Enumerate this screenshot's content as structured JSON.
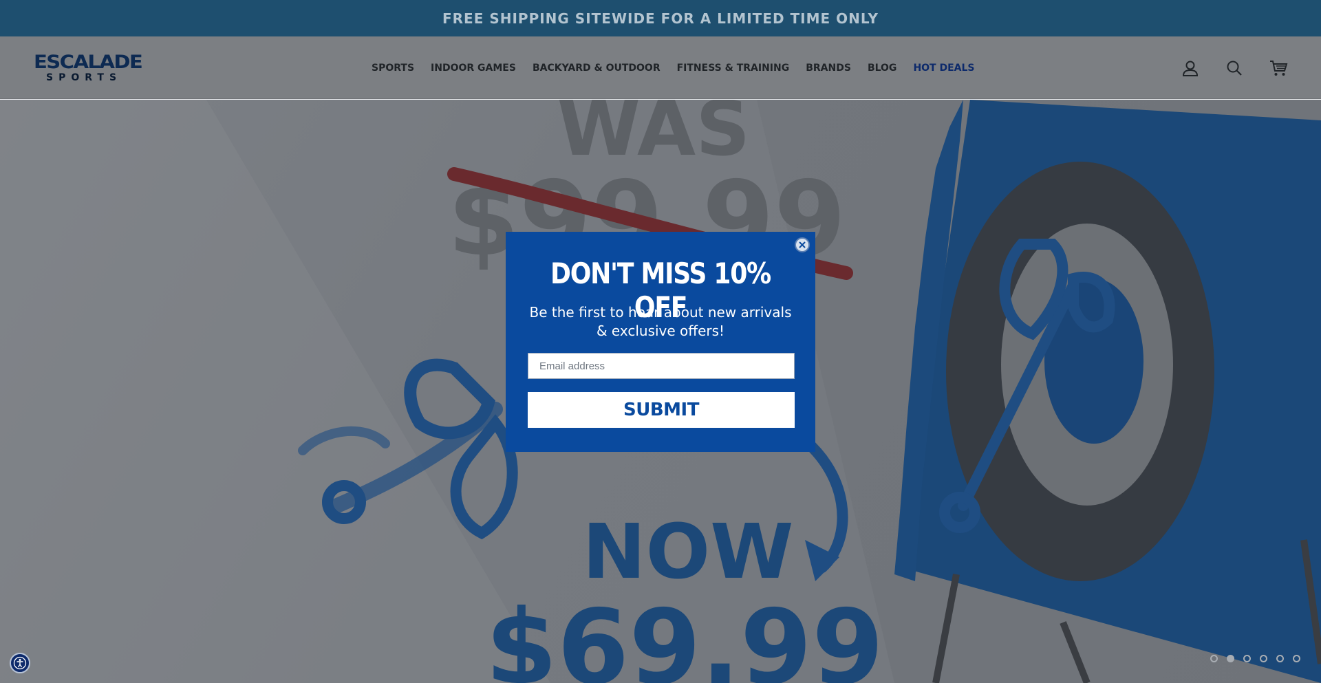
{
  "announcement": {
    "text": "FREE SHIPPING SITEWIDE FOR A LIMITED TIME ONLY"
  },
  "header": {
    "logo_top": "ESCALADE",
    "logo_bottom": "SPORTS",
    "nav": [
      {
        "label": "SPORTS"
      },
      {
        "label": "INDOOR GAMES"
      },
      {
        "label": "BACKYARD & OUTDOOR"
      },
      {
        "label": "FITNESS & TRAINING"
      },
      {
        "label": "BRANDS"
      },
      {
        "label": "BLOG"
      },
      {
        "label": "HOT DEALS"
      }
    ],
    "icons": [
      "account-icon",
      "search-icon",
      "cart-icon"
    ]
  },
  "hero": {
    "was_label": "WAS",
    "old_price": "$99.99",
    "now_label": "NOW",
    "new_price": "$69.99",
    "slide_count": 6,
    "active_slide": 2
  },
  "popup": {
    "title": "DON'T MISS 10% OFF",
    "subtitle": "Be the first to hear about new arrivals & exclusive offers!",
    "email_placeholder": "Email address",
    "submit_label": "SUBMIT"
  },
  "colors": {
    "announcement_bg": "#1e4f6f",
    "popup_bg": "#0a4a9e",
    "brand_navy": "#0d2a6b"
  }
}
